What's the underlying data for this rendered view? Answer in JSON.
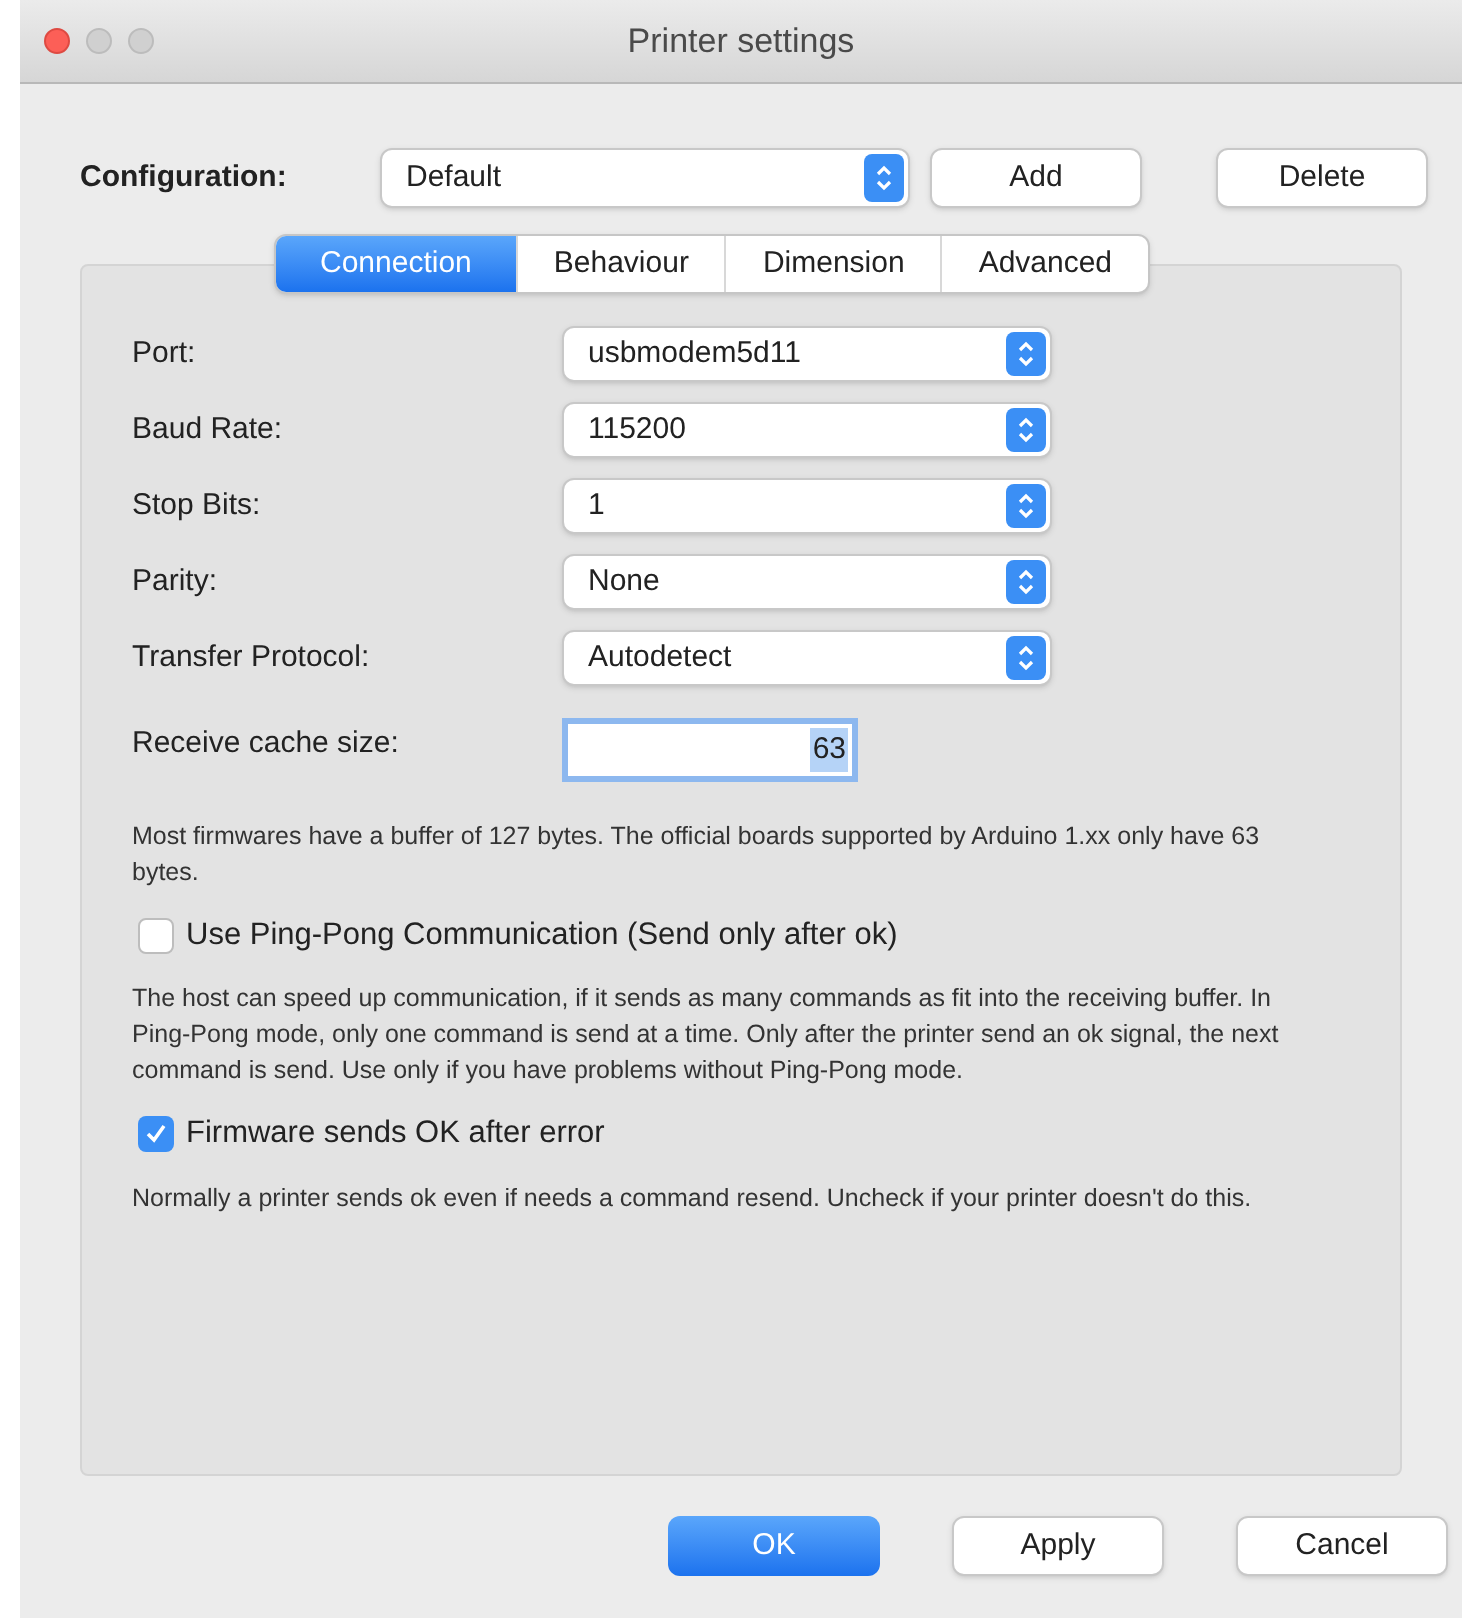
{
  "window": {
    "title": "Printer settings"
  },
  "configuration": {
    "label": "Configuration:",
    "value": "Default",
    "buttons": [
      "Add",
      "Delete"
    ]
  },
  "tabs": [
    {
      "label": "Connection",
      "selected": true
    },
    {
      "label": "Behaviour",
      "selected": false
    },
    {
      "label": "Dimension",
      "selected": false
    },
    {
      "label": "Advanced",
      "selected": false
    }
  ],
  "fields": [
    {
      "kind": "select",
      "label": "Port:",
      "value": "usbmodem5d11"
    },
    {
      "kind": "select",
      "label": "Baud Rate:",
      "value": "115200"
    },
    {
      "kind": "select",
      "label": "Stop Bits:",
      "value": "1"
    },
    {
      "kind": "select",
      "label": "Parity:",
      "value": "None"
    },
    {
      "kind": "select",
      "label": "Transfer Protocol:",
      "value": "Autodetect"
    },
    {
      "kind": "number",
      "label": "Receive cache size:",
      "value": "63"
    }
  ],
  "options": [
    {
      "kind": "note",
      "text": "Most firmwares have a buffer of 127 bytes. The official boards supported by Arduino 1.xx only have 63 bytes."
    },
    {
      "kind": "checkbox",
      "label": "Use Ping-Pong Communication (Send only after ok)",
      "checked": false
    },
    {
      "kind": "note",
      "text": "The host can speed up communication, if it sends as many commands as fit into the receiving buffer. In Ping-Pong mode, only one command is send at a time. Only after the printer send an ok signal, the next command is send. Use only if you have problems without Ping-Pong mode."
    },
    {
      "kind": "checkbox",
      "label": "Firmware sends OK after error",
      "checked": true
    },
    {
      "kind": "note",
      "text": "Normally a printer sends ok even if needs a command resend. Uncheck if your printer doesn't do this."
    }
  ],
  "buttons": [
    {
      "label": "OK",
      "default": true
    },
    {
      "label": "Apply",
      "default": false
    },
    {
      "label": "Cancel",
      "default": false
    }
  ]
}
